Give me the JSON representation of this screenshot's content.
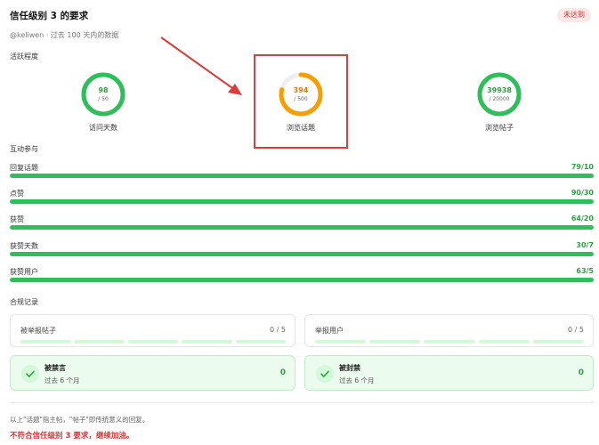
{
  "header": {
    "title": "信任级别 3 的要求",
    "status_badge": "未达到",
    "subtitle": "@keliwen · 过去 100 天内的数据"
  },
  "activity": {
    "section_label": "活跃程度",
    "rings": [
      {
        "value": "98",
        "max": "/ 50",
        "label": "访问天数",
        "progress": 1.0,
        "color": "#2fbf5a",
        "value_color": "#2f9e44"
      },
      {
        "value": "394",
        "max": "/ 500",
        "label": "浏览话题",
        "progress": 0.788,
        "color": "#f59f00",
        "value_color": "#e67700"
      },
      {
        "value": "39938",
        "max": "/ 20000",
        "label": "浏览帖子",
        "progress": 1.0,
        "color": "#2fbf5a",
        "value_color": "#2f9e44"
      }
    ]
  },
  "engagement": {
    "section_label": "互动参与",
    "bars": [
      {
        "label": "回复话题",
        "value": "79/10",
        "progress": 1.0
      },
      {
        "label": "点赞",
        "value": "90/30",
        "progress": 1.0
      },
      {
        "label": "获赞",
        "value": "64/20",
        "progress": 1.0
      },
      {
        "label": "获赞天数",
        "value": "30/7",
        "progress": 1.0
      },
      {
        "label": "获赞用户",
        "value": "63/5",
        "progress": 1.0
      }
    ]
  },
  "compliance": {
    "section_label": "合规记录",
    "flagged_posts": {
      "label": "被举报帖子",
      "value": "0 / 5"
    },
    "flagged_users": {
      "label": "举报用户",
      "value": "0 / 5"
    },
    "silenced": {
      "title": "被禁言",
      "sub": "过去 6 个月",
      "count": "0"
    },
    "suspended": {
      "title": "被封禁",
      "sub": "过去 6 个月",
      "count": "0"
    }
  },
  "footer": {
    "note": "以上\"话题\"指主帖，\"帖子\"即传统意义的回复。",
    "result": "不符合信任级别 3 要求，继续加油。"
  },
  "colors": {
    "accent_green": "#2fbf5a",
    "accent_orange": "#f59f00",
    "alert_red": "#e03131"
  }
}
